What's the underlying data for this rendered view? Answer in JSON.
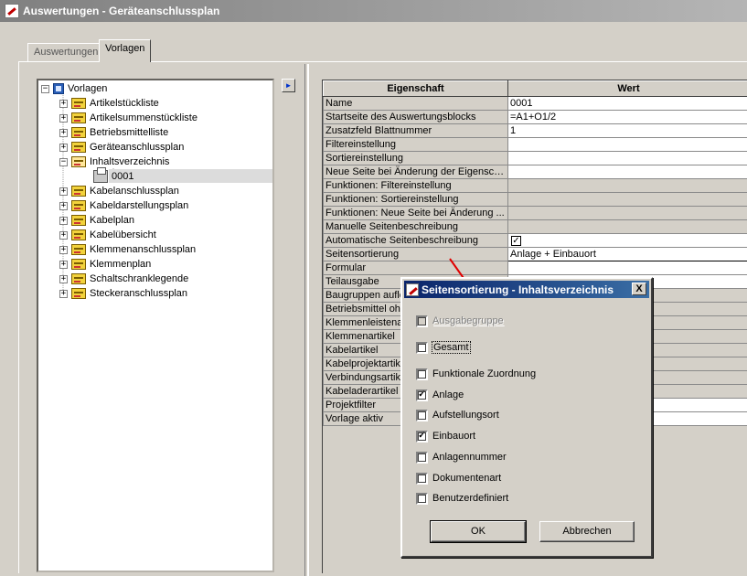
{
  "window": {
    "title": "Auswertungen - Geräteanschlussplan"
  },
  "tabs": [
    {
      "label": "Auswertungen",
      "active": false
    },
    {
      "label": "Vorlagen",
      "active": true
    }
  ],
  "tree": {
    "root": "Vorlagen",
    "items": [
      {
        "label": "Artikelstückliste",
        "expanded": false
      },
      {
        "label": "Artikelsummenstückliste",
        "expanded": false
      },
      {
        "label": "Betriebsmittelliste",
        "expanded": false
      },
      {
        "label": "Geräteanschlussplan",
        "expanded": false
      },
      {
        "label": "Inhaltsverzeichnis",
        "expanded": true
      },
      {
        "label": "Kabelanschlussplan",
        "expanded": false
      },
      {
        "label": "Kabeldarstellungsplan",
        "expanded": false
      },
      {
        "label": "Kabelplan",
        "expanded": false
      },
      {
        "label": "Kabelübersicht",
        "expanded": false
      },
      {
        "label": "Klemmenanschlussplan",
        "expanded": false
      },
      {
        "label": "Klemmenplan",
        "expanded": false
      },
      {
        "label": "Schaltschranklegende",
        "expanded": false
      },
      {
        "label": "Steckeranschlussplan",
        "expanded": false
      }
    ],
    "child": {
      "label": "0001",
      "selected": true
    }
  },
  "arrow_button": "►",
  "grid": {
    "headers": {
      "property": "Eigenschaft",
      "value": "Wert"
    },
    "rows": [
      {
        "property": "Name",
        "value": "0001"
      },
      {
        "property": "Startseite des Auswertungsblocks",
        "value": "=A1+O1/2"
      },
      {
        "property": "Zusatzfeld Blattnummer",
        "value": "1"
      },
      {
        "property": "Filtereinstellung",
        "value": ""
      },
      {
        "property": "Sortiereinstellung",
        "value": ""
      },
      {
        "property": "Neue Seite bei Änderung der Eigenschaft",
        "value": ""
      },
      {
        "property": "Funktionen: Filtereinstellung",
        "value": ""
      },
      {
        "property": "Funktionen: Sortiereinstellung",
        "value": ""
      },
      {
        "property": "Funktionen: Neue Seite bei Änderung ...",
        "value": ""
      },
      {
        "property": "Manuelle Seitenbeschreibung",
        "value": ""
      },
      {
        "property": "Automatische Seitenbeschreibung",
        "value": "✓"
      },
      {
        "property": "Seitensortierung",
        "value": "Anlage + Einbauort"
      },
      {
        "property": "Formular",
        "value": ""
      },
      {
        "property": "Teilausgabe",
        "value": ""
      },
      {
        "property": "Baugruppen auflö",
        "value": ""
      },
      {
        "property": "Betriebsmittel ohn",
        "value": ""
      },
      {
        "property": "Klemmenleistenar",
        "value": ""
      },
      {
        "property": "Klemmenartikel",
        "value": ""
      },
      {
        "property": "Kabelartikel",
        "value": ""
      },
      {
        "property": "Kabelprojektartik",
        "value": ""
      },
      {
        "property": "Verbindungsartik",
        "value": ""
      },
      {
        "property": "Kabeladerartikel",
        "value": ""
      },
      {
        "property": "Projektfilter",
        "value": ""
      },
      {
        "property": "Vorlage aktiv",
        "value": ""
      }
    ]
  },
  "dialog": {
    "title": "Seitensortierung - Inhaltsverzeichnis",
    "close": "X",
    "options": [
      {
        "label": "Ausgabegruppe",
        "checked": false,
        "disabled": true
      },
      {
        "label": "Gesamt",
        "checked": false,
        "disabled": false,
        "focused": true
      },
      {
        "label": "Funktionale Zuordnung",
        "checked": false,
        "disabled": false
      },
      {
        "label": "Anlage",
        "checked": true,
        "disabled": false
      },
      {
        "label": "Aufstellungsort",
        "checked": false,
        "disabled": false
      },
      {
        "label": "Einbauort",
        "checked": true,
        "disabled": false
      },
      {
        "label": "Anlagennummer",
        "checked": false,
        "disabled": false
      },
      {
        "label": "Dokumentenart",
        "checked": false,
        "disabled": false
      },
      {
        "label": "Benutzerdefiniert",
        "checked": false,
        "disabled": false
      }
    ],
    "ok_label": "OK",
    "cancel_label": "Abbrechen",
    "check_glyph": "✓"
  },
  "colors": {
    "dialog_title_start": "#0a246a",
    "dialog_title_end": "#3a6ea5",
    "annotation_line": "#e00000"
  }
}
